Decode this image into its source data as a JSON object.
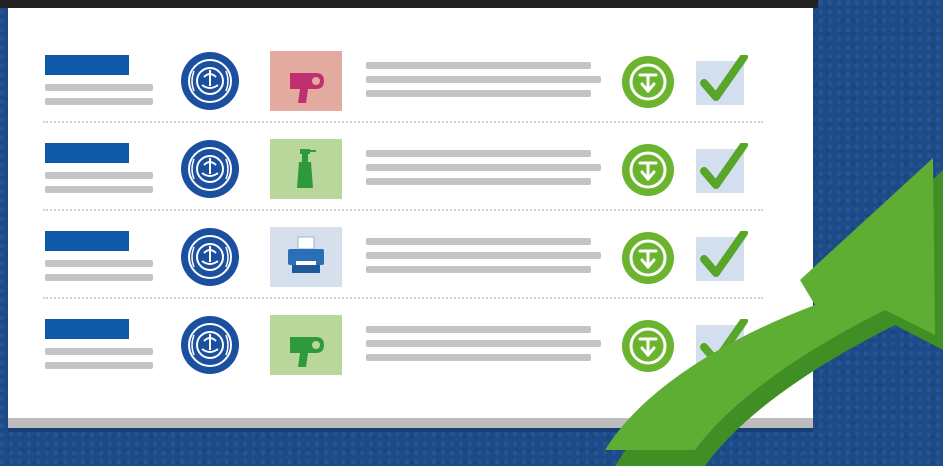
{
  "document_list": {
    "rows": [
      {
        "product_icon": "hair-dryer-icon",
        "product_bg": "#e3aaa0",
        "product_color": "#c0306e"
      },
      {
        "product_icon": "spray-bottle-icon",
        "product_bg": "#b9d79b",
        "product_color": "#2f9a3b"
      },
      {
        "product_icon": "printer-icon",
        "product_bg": "#d5e0ec",
        "product_color": "#2a6fb8"
      },
      {
        "product_icon": "hair-dryer-icon",
        "product_bg": "#b9d79b",
        "product_color": "#2f9a3b"
      }
    ],
    "seal_icon": "blauer-engel-seal-icon",
    "download_icon": "download-icon",
    "check_icon": "checkmark-icon"
  },
  "decor": {
    "arrow_icon": "green-arrow-icon",
    "colors": {
      "background": "#1d4b8a",
      "title_bar": "#0e5aa8",
      "placeholder_line": "#c4c4c4",
      "download_green": "#6ab42e",
      "check_green": "#58a629",
      "check_bg": "#d3dfee",
      "arrow_green": "#5fae34"
    }
  }
}
